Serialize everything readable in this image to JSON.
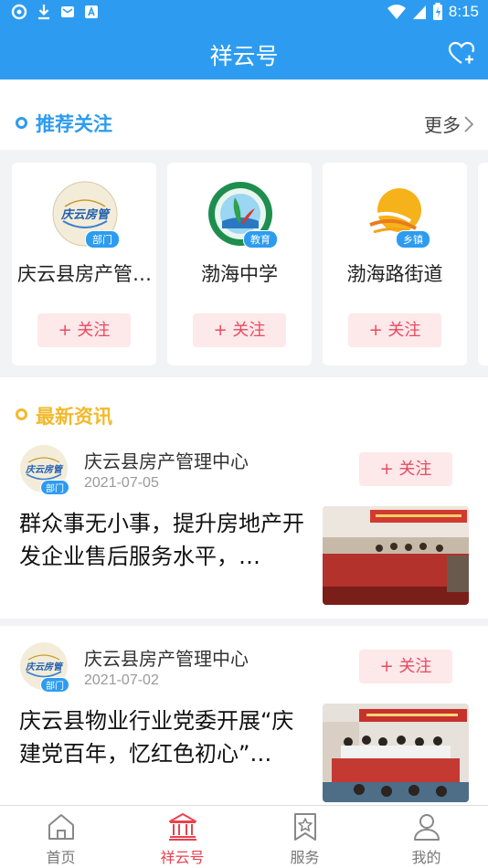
{
  "status_bar": {
    "time": "8:15"
  },
  "header": {
    "title": "祥云号"
  },
  "recommend": {
    "title": "推荐关注",
    "more_label": "更多",
    "follow_label": "+ 关注",
    "items": [
      {
        "name": "庆云县房产管…",
        "tag": "部门",
        "logo_text": "庆云房管"
      },
      {
        "name": "渤海中学",
        "tag": "教育"
      },
      {
        "name": "渤海路街道",
        "tag": "乡镇"
      }
    ]
  },
  "news": {
    "title": "最新资讯",
    "follow_label": "+ 关注",
    "items": [
      {
        "source": "庆云县房产管理中心",
        "date": "2021-07-05",
        "tag": "部门",
        "logo_text": "庆云房管",
        "headline": "群众事无小事，提升房地产开发企业售后服务水平，…"
      },
      {
        "source": "庆云县房产管理中心",
        "date": "2021-07-02",
        "tag": "部门",
        "logo_text": "庆云房管",
        "headline": "庆云县物业行业党委开展“庆建党百年，忆红色初心”…"
      }
    ]
  },
  "bottom_nav": {
    "items": [
      {
        "label": "首页",
        "icon": "home-icon"
      },
      {
        "label": "祥云号",
        "icon": "bank-icon",
        "active": true
      },
      {
        "label": "服务",
        "icon": "star-bookmark-icon"
      },
      {
        "label": "我的",
        "icon": "user-icon"
      }
    ]
  },
  "colors": {
    "primary": "#2d9cf0",
    "accent": "#e8424f",
    "recommend_dot": "#2d9cf0",
    "news_dot": "#f2b92c"
  }
}
